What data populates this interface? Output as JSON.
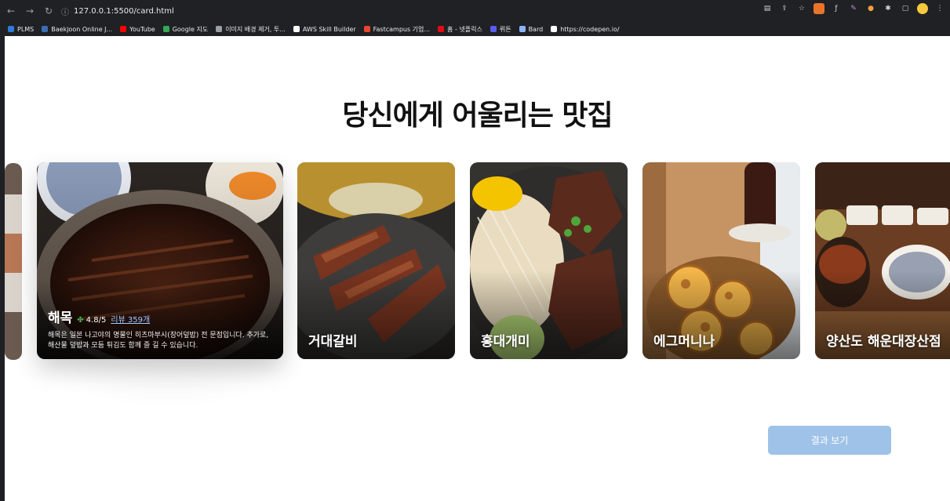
{
  "browser": {
    "url": "127.0.0.1:5500/card.html",
    "bookmarks": [
      {
        "label": "PLMS",
        "color": "#2f7bd6"
      },
      {
        "label": "Baekjoon Online J...",
        "color": "#3b6fb5"
      },
      {
        "label": "YouTube",
        "color": "#ff0000"
      },
      {
        "label": "Google 지도",
        "color": "#34a853"
      },
      {
        "label": "이미지 배경 제거, 투...",
        "color": "#9aa0a6"
      },
      {
        "label": "AWS Skill Builder",
        "color": "#ffffff"
      },
      {
        "label": "Fastcampus 기업...",
        "color": "#e8462f"
      },
      {
        "label": "홈 - 넷플릭스",
        "color": "#e50914"
      },
      {
        "label": "뤼튼",
        "color": "#5b5bf0"
      },
      {
        "label": "Bard",
        "color": "#8ab4f8"
      },
      {
        "label": "https://codepen.io/",
        "color": "#ffffff"
      }
    ]
  },
  "page": {
    "title": "당신에게 어울리는 맛집"
  },
  "active_card": {
    "name": "해목",
    "rating": "4.8/5",
    "reviews": "리뷰 359개",
    "description": "해목은 일본 나고야의 명물인 히츠마부시(장어덮밥) 전 문점입니다. 추가로, 해산물 덮밥과 모둠 튀김도 함께 즐 길 수 있습니다."
  },
  "cards": [
    {
      "name": "거대갈비"
    },
    {
      "name": "홍대개미"
    },
    {
      "name": "에그머니나"
    },
    {
      "name": "양산도 해운대장산점"
    }
  ],
  "result_button": "결과 보기"
}
